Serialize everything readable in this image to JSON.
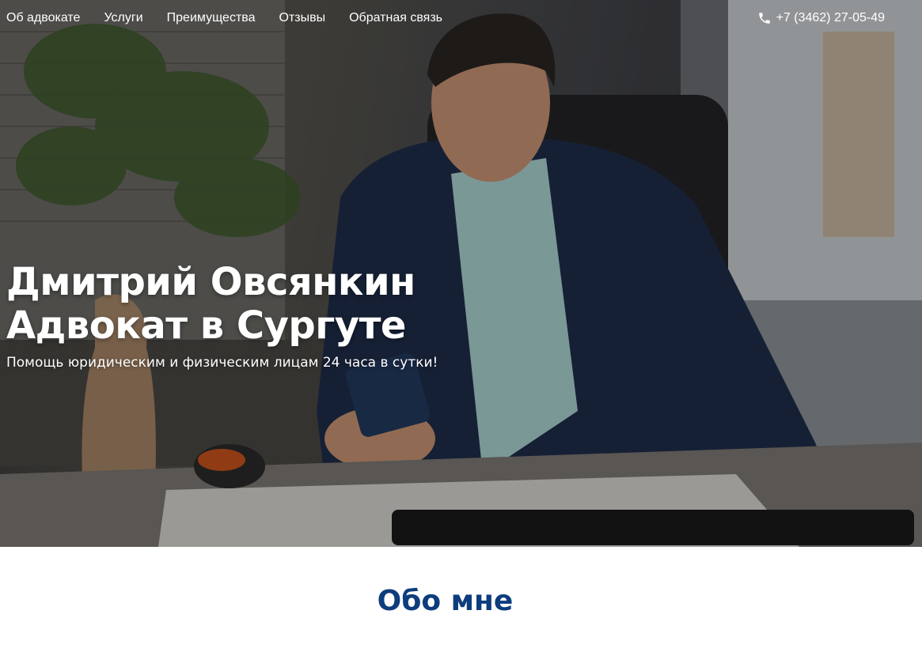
{
  "nav": {
    "items": [
      {
        "label": "Об адвокате"
      },
      {
        "label": "Услуги"
      },
      {
        "label": "Преимущества"
      },
      {
        "label": "Отзывы"
      },
      {
        "label": "Обратная связь"
      }
    ]
  },
  "contact": {
    "phone": "+7 (3462) 27-05-49",
    "icon": "phone-icon"
  },
  "hero": {
    "title_line1": "Дмитрий Овсянкин",
    "title_line2": "Адвокат в Сургуте",
    "subtitle": "Помощь юридическим и физическим лицам 24 часа в сутки!"
  },
  "about": {
    "heading": "Обо мне"
  },
  "colors": {
    "heading_blue": "#0d3d7d",
    "hero_text": "#ffffff"
  }
}
